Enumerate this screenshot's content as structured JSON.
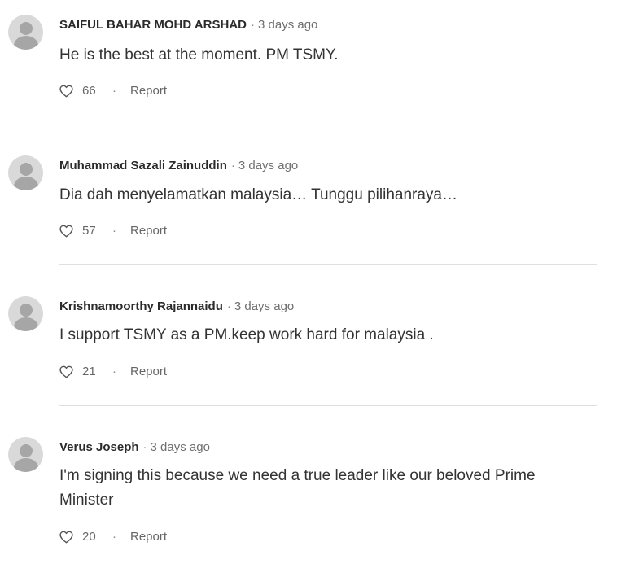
{
  "comments": [
    {
      "author": "SAIFUL BAHAR MOHD ARSHAD",
      "separator": "·",
      "time": "3 days ago",
      "text": "He is the best at the moment. PM TSMY.",
      "likes": "66",
      "action_separator": "·",
      "report_label": "Report",
      "like_icon": "heart-outline-icon"
    },
    {
      "author": "Muhammad Sazali Zainuddin",
      "separator": "·",
      "time": "3 days ago",
      "text": "Dia dah menyelamatkan malaysia… Tunggu pilihanraya…",
      "likes": "57",
      "action_separator": "·",
      "report_label": "Report",
      "like_icon": "heart-outline-icon"
    },
    {
      "author": "Krishnamoorthy Rajannaidu",
      "separator": "·",
      "time": "3 days ago",
      "text": "I support TSMY as a PM.keep work hard for malaysia .",
      "likes": "21",
      "action_separator": "·",
      "report_label": "Report",
      "like_icon": "heart-outline-icon"
    },
    {
      "author": "Verus Joseph",
      "separator": "·",
      "time": "3 days ago",
      "text": "I'm signing this because we need a true leader like our beloved Prime Minister",
      "likes": "20",
      "action_separator": "·",
      "report_label": "Report",
      "like_icon": "heart-outline-icon"
    }
  ],
  "colors": {
    "avatar_bg": "#d9d9d9",
    "avatar_fg": "#a6a6a6",
    "divider": "#e0e0e0",
    "text": "#333333",
    "muted": "#6f6f6f"
  }
}
